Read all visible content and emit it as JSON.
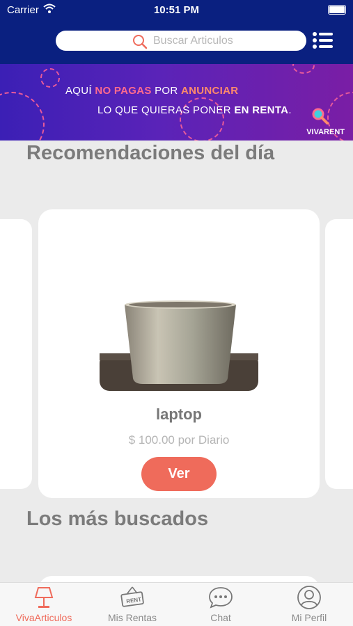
{
  "status_bar": {
    "carrier": "Carrier",
    "time": "10:51 PM"
  },
  "header": {
    "search_placeholder": "Buscar Articulos",
    "icons": [
      "search-icon",
      "menu-list-icon"
    ]
  },
  "banner": {
    "line1": {
      "part1": "AQUÍ ",
      "part2": "NO PAGAS",
      "part3": " POR ",
      "part4": "ANUNCIAR"
    },
    "line2": {
      "part1": "LO QUE QUIERAS PONER ",
      "part2": "EN RENTA",
      "part3": "."
    },
    "brand": "VIVARENT"
  },
  "sections": {
    "recommended_title": "Recomendaciones del día",
    "most_searched_title": "Los más buscados"
  },
  "featured_item": {
    "name": "laptop",
    "price": "$ 100.00 por Diario",
    "button": "Ver"
  },
  "tabs": [
    {
      "label": "VivaArticulos",
      "icon": "lamp-icon",
      "active": true
    },
    {
      "label": "Mis Rentas",
      "icon": "rent-sign-icon",
      "active": false
    },
    {
      "label": "Chat",
      "icon": "chat-bubble-icon",
      "active": false
    },
    {
      "label": "Mi Perfil",
      "icon": "user-profile-icon",
      "active": false
    }
  ],
  "colors": {
    "navy": "#0a2080",
    "accent": "#ef6b5b",
    "background": "#ebebeb"
  }
}
